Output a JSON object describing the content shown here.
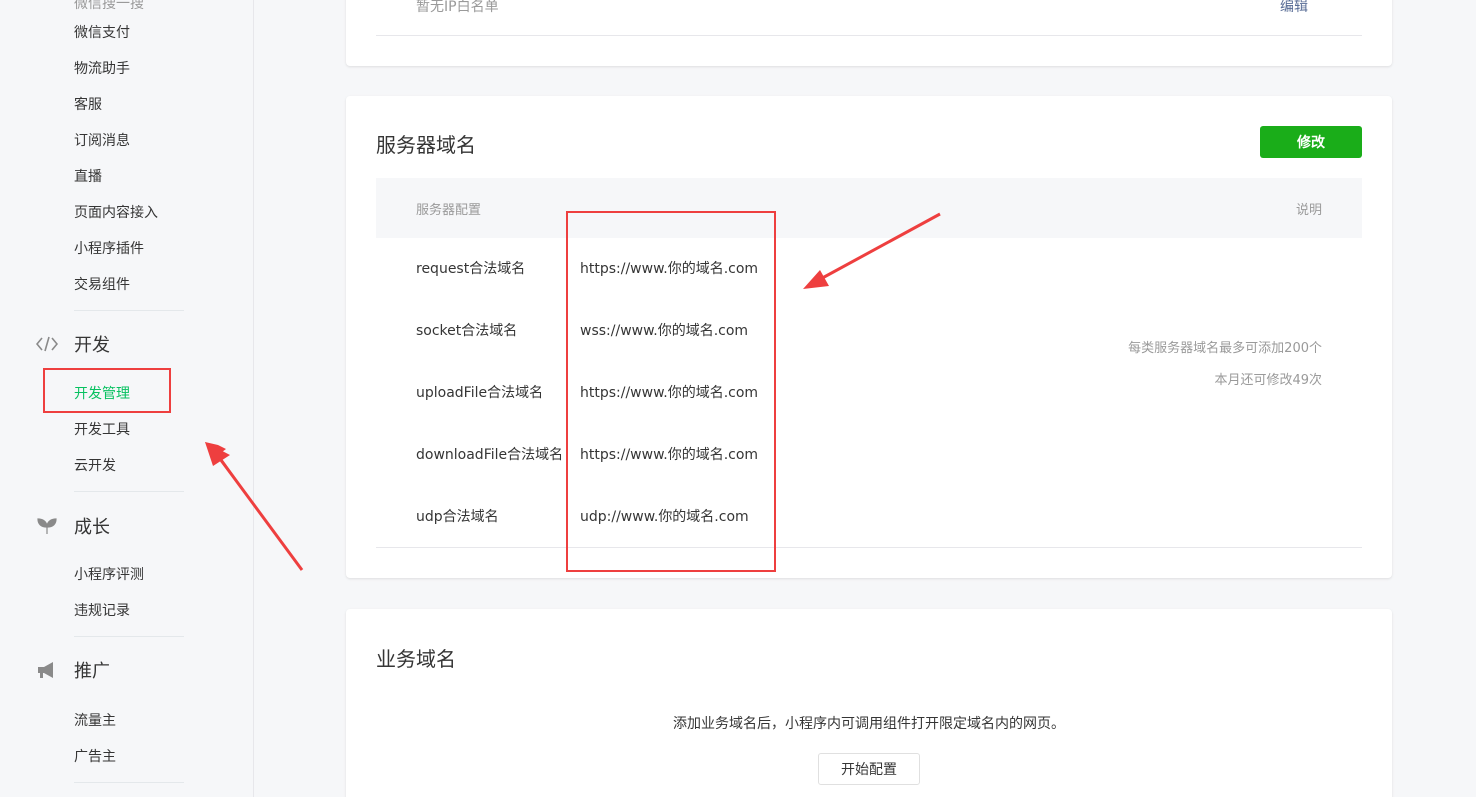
{
  "sidebar": {
    "items_top": [
      {
        "label": "微信支付",
        "name": "sidebar-item-wechat-pay"
      },
      {
        "label": "物流助手",
        "name": "sidebar-item-logistics"
      },
      {
        "label": "客服",
        "name": "sidebar-item-customer-service"
      },
      {
        "label": "订阅消息",
        "name": "sidebar-item-subscribe"
      },
      {
        "label": "直播",
        "name": "sidebar-item-live"
      },
      {
        "label": "页面内容接入",
        "name": "sidebar-item-page-content"
      },
      {
        "label": "小程序插件",
        "name": "sidebar-item-plugin"
      },
      {
        "label": "交易组件",
        "name": "sidebar-item-trade"
      }
    ],
    "dev_group": {
      "label": "开发",
      "icon": "code-icon"
    },
    "dev_items": [
      {
        "label": "开发管理",
        "name": "sidebar-item-dev-manage",
        "active": true
      },
      {
        "label": "开发工具",
        "name": "sidebar-item-dev-tools"
      },
      {
        "label": "云开发",
        "name": "sidebar-item-cloud"
      }
    ],
    "growth_group": {
      "label": "成长",
      "icon": "sprout-icon"
    },
    "growth_items": [
      {
        "label": "小程序评测",
        "name": "sidebar-item-evaluation"
      },
      {
        "label": "违规记录",
        "name": "sidebar-item-violations"
      }
    ],
    "promo_group": {
      "label": "推广",
      "icon": "megaphone-icon"
    },
    "promo_items": [
      {
        "label": "流量主",
        "name": "sidebar-item-traffic"
      },
      {
        "label": "广告主",
        "name": "sidebar-item-advertiser"
      }
    ],
    "active_color": "#07c160"
  },
  "top_card": {
    "row_label": "暂无IP白名单",
    "row_link": "编辑"
  },
  "server_domain": {
    "title": "服务器域名",
    "modify_label": "修改",
    "header_config": "服务器配置",
    "header_note": "说明",
    "rows": [
      {
        "key": "request合法域名",
        "value": "https://www.你的域名.com"
      },
      {
        "key": "socket合法域名",
        "value": "wss://www.你的域名.com"
      },
      {
        "key": "uploadFile合法域名",
        "value": "https://www.你的域名.com"
      },
      {
        "key": "downloadFile合法域名",
        "value": "https://www.你的域名.com"
      },
      {
        "key": "udp合法域名",
        "value": "udp://www.你的域名.com"
      }
    ],
    "note_line1": "每类服务器域名最多可添加200个",
    "note_line2": "本月还可修改49次",
    "button_color": "#1aad19"
  },
  "business_domain": {
    "title": "业务域名",
    "description": "添加业务域名后，小程序内可调用组件打开限定域名内的网页。",
    "start_label": "开始配置"
  },
  "annotation_color": "#ee3f3f"
}
